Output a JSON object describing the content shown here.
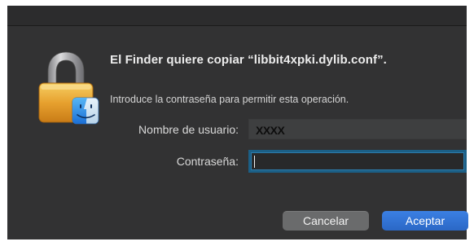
{
  "dialog": {
    "title": "El Finder quiere copiar “libbit4xpki.dylib.conf”.",
    "message": "Introduce la contraseña para permitir esta operación.",
    "icon": "lock-with-finder-icon"
  },
  "form": {
    "username_label": "Nombre de usuario:",
    "username_value": "XXXX",
    "password_label": "Contraseña:",
    "password_value": ""
  },
  "buttons": {
    "cancel_label": "Cancelar",
    "accept_label": "Aceptar"
  },
  "colors": {
    "background": "#323233",
    "accent": "#2f72d6",
    "focus_ring": "#1b5f86"
  }
}
